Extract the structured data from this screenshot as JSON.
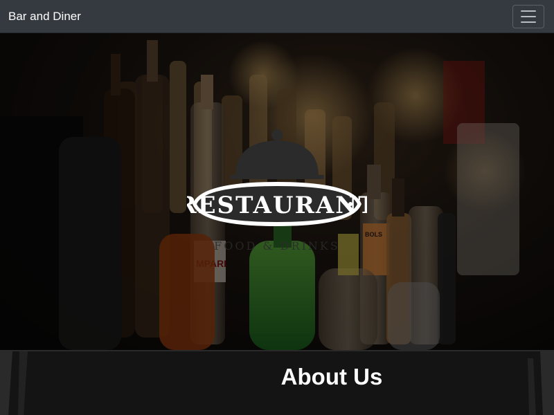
{
  "navbar": {
    "brand": "Bar and Diner",
    "toggle_icon": "hamburger-icon"
  },
  "hero": {
    "logo": {
      "icon": "cloche-icon",
      "title": "RESTAURANT",
      "subtitle": "FOOD & DRINKS"
    }
  },
  "about": {
    "heading": "About Us"
  },
  "colors": {
    "navbar_bg": "#343a40",
    "section_bg": "#141414",
    "logo_fill": "#2b2b2b",
    "logo_text": "#ffffff"
  }
}
